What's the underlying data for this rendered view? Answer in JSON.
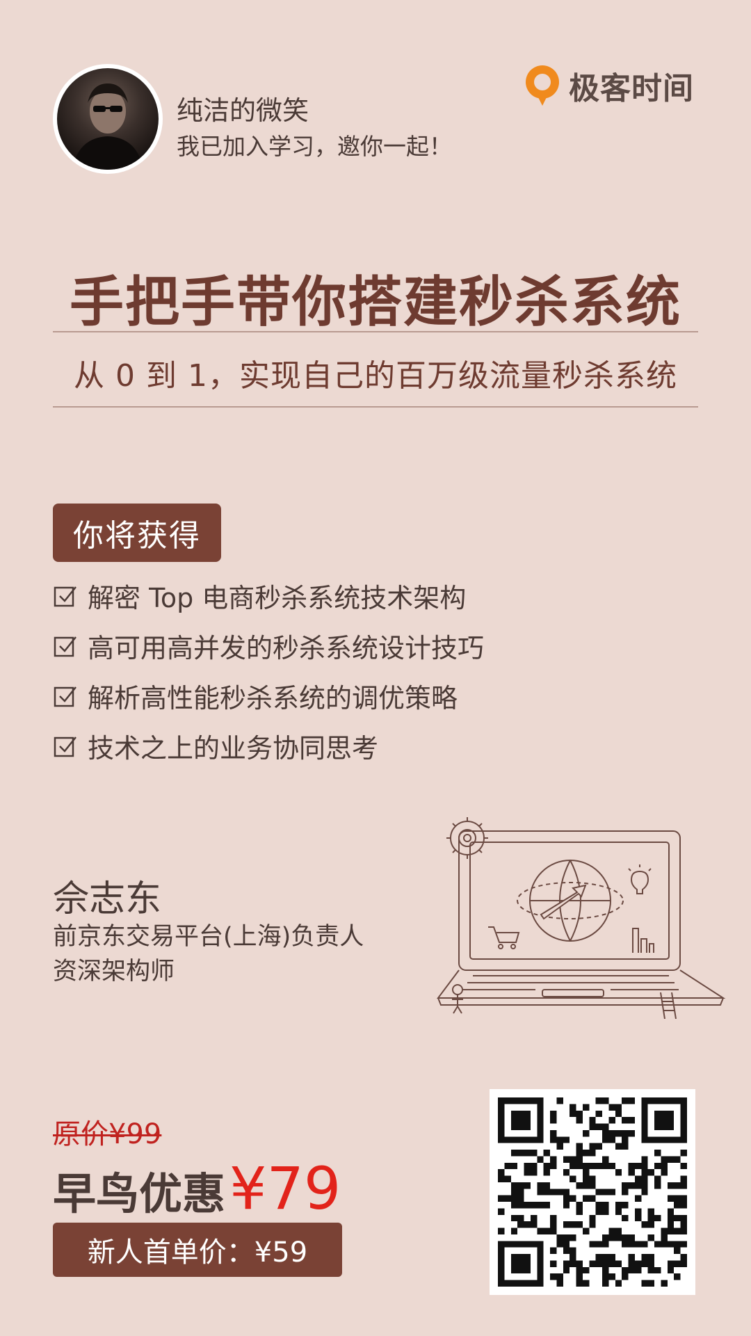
{
  "header": {
    "username": "纯洁的微笑",
    "invite_text": "我已加入学习，邀你一起！",
    "logo_text": "极客时间",
    "logo_color": "#f08a1d"
  },
  "course": {
    "title": "手把手带你搭建秒杀系统",
    "subtitle": "从 0 到 1，实现自己的百万级流量秒杀系统"
  },
  "gains": {
    "badge_label": "你将获得",
    "items": [
      "解密 Top 电商秒杀系统技术架构",
      "高可用高并发的秒杀系统设计技巧",
      "解析高性能秒杀系统的调优策略",
      "技术之上的业务协同思考"
    ]
  },
  "author": {
    "name": "佘志东",
    "role": "前京东交易平台(上海)负责人",
    "title": "资深架构师"
  },
  "pricing": {
    "original_price": "原价¥99",
    "early_label": "早鸟优惠",
    "early_amount": "¥79",
    "new_user_price": "新人首单价：¥59"
  },
  "colors": {
    "background": "#ecd9d2",
    "accent_brown": "#7a4235",
    "price_red": "#e2231a"
  },
  "icons": {
    "avatar": "avatar-photo",
    "logo": "geektime-logo-icon",
    "check": "checkbox-checked-icon",
    "illustration": "laptop-illustration",
    "qr": "qr-code"
  }
}
